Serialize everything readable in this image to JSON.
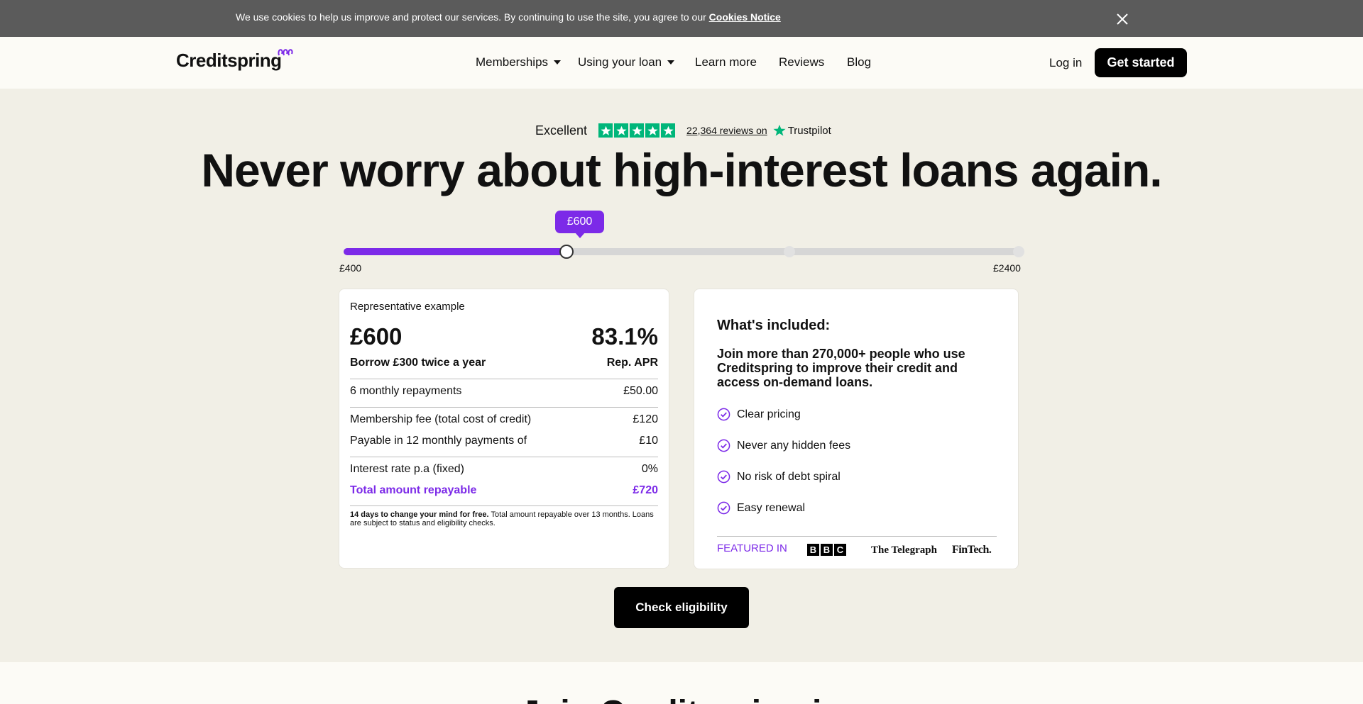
{
  "cookie": {
    "text": "We use cookies to help us improve and protect our services. By continuing to use the site, you agree to our",
    "link": "Cookies Notice"
  },
  "nav": {
    "logo": "Creditspring",
    "items": [
      {
        "label": "Memberships",
        "dropdown": true
      },
      {
        "label": "Using your loan",
        "dropdown": true
      },
      {
        "label": "Learn more",
        "dropdown": false
      },
      {
        "label": "Reviews",
        "dropdown": false
      },
      {
        "label": "Blog",
        "dropdown": false
      }
    ],
    "login": "Log in",
    "cta": "Get started"
  },
  "trustpilot": {
    "rating_label": "Excellent",
    "stars": 5,
    "reviews_link": "22,364 reviews on",
    "brand": "Trustpilot",
    "color": "#00b67a"
  },
  "hero": {
    "title": "Never worry about high-interest loans again."
  },
  "slider": {
    "min_label": "£400",
    "max_label": "£2400",
    "value_label": "£600",
    "fill_fraction": 0.33,
    "stops": [
      0.0,
      0.33,
      0.66,
      1.0
    ]
  },
  "representative": {
    "heading": "Representative example",
    "amount": "£600",
    "apr": "83.1%",
    "borrow_text": "Borrow £300 twice a year",
    "apr_label": "Rep. APR",
    "rows": [
      {
        "label": "6 monthly repayments",
        "value": "£50.00"
      },
      {
        "label": "Membership fee (total cost of credit)",
        "value": "£120"
      },
      {
        "label": "Payable in 12 monthly payments of",
        "value": "£10"
      },
      {
        "label": "Interest rate p.a (fixed)",
        "value": "0%"
      },
      {
        "label": "Total amount repayable",
        "value": "£720"
      }
    ],
    "fine_bold": "14 days to change your mind for free.",
    "fine_rest": "Total amount repayable over 13 months. Loans are subject to status and eligibility checks."
  },
  "included": {
    "title": "What's included:",
    "description": "Join more than 270,000+ people who use Creditspring to improve their credit and access on-demand loans.",
    "items": [
      "Clear pricing",
      "Never any hidden fees",
      "No risk of debt spiral",
      "Easy renewal"
    ],
    "featured_label": "FEATURED IN",
    "logos": [
      "B",
      "B",
      "C"
    ],
    "telegraph": "The Telegraph",
    "fintech": "FinTech."
  },
  "cta": {
    "check": "Check eligibility"
  },
  "bottom": {
    "title_partial": "Join Creditspring in"
  },
  "colors": {
    "accent": "#7c2ae8",
    "background": "#f1efe6",
    "cookie_bar": "#5b5b5b"
  }
}
